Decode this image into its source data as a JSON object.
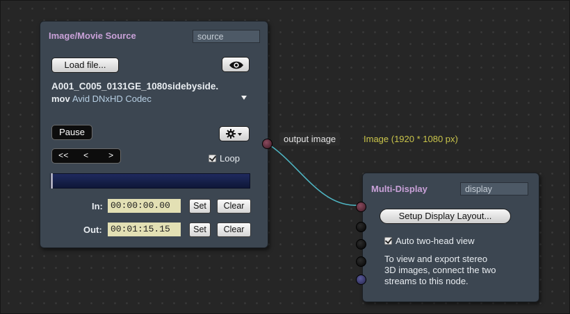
{
  "source_node": {
    "title": "Image/Movie Source",
    "name_value": "source",
    "load_button": "Load file...",
    "filename_line1": "A001_C005_0131GE_1080sidebyside.",
    "filename_ext": "mov",
    "codec": "Avid DNxHD Codec",
    "pause_button": "Pause",
    "nav_buttons": "<<   <    >",
    "loop_label": "Loop",
    "loop_checked": true,
    "in_label": "In:",
    "in_value": "00:00:00.00",
    "out_label": "Out:",
    "out_value": "00:01:15.15",
    "set_label": "Set",
    "clear_label": "Clear"
  },
  "connection": {
    "output_label": "output image",
    "output_info": "Image (1920 * 1080 px)",
    "info_color": "#c9c44a",
    "wire_color": "#4fb6c4"
  },
  "display_node": {
    "title": "Multi-Display",
    "name_value": "display",
    "setup_button": "Setup Display Layout...",
    "auto_label": "Auto two-head view",
    "auto_checked": true,
    "help_text_1": "To view and export stereo",
    "help_text_2": "3D images, connect the two",
    "help_text_3": "streams to this node."
  },
  "icons": {
    "eye": "eye-icon",
    "gear": "gear-icon",
    "disclosure": "triangle-down-icon"
  }
}
